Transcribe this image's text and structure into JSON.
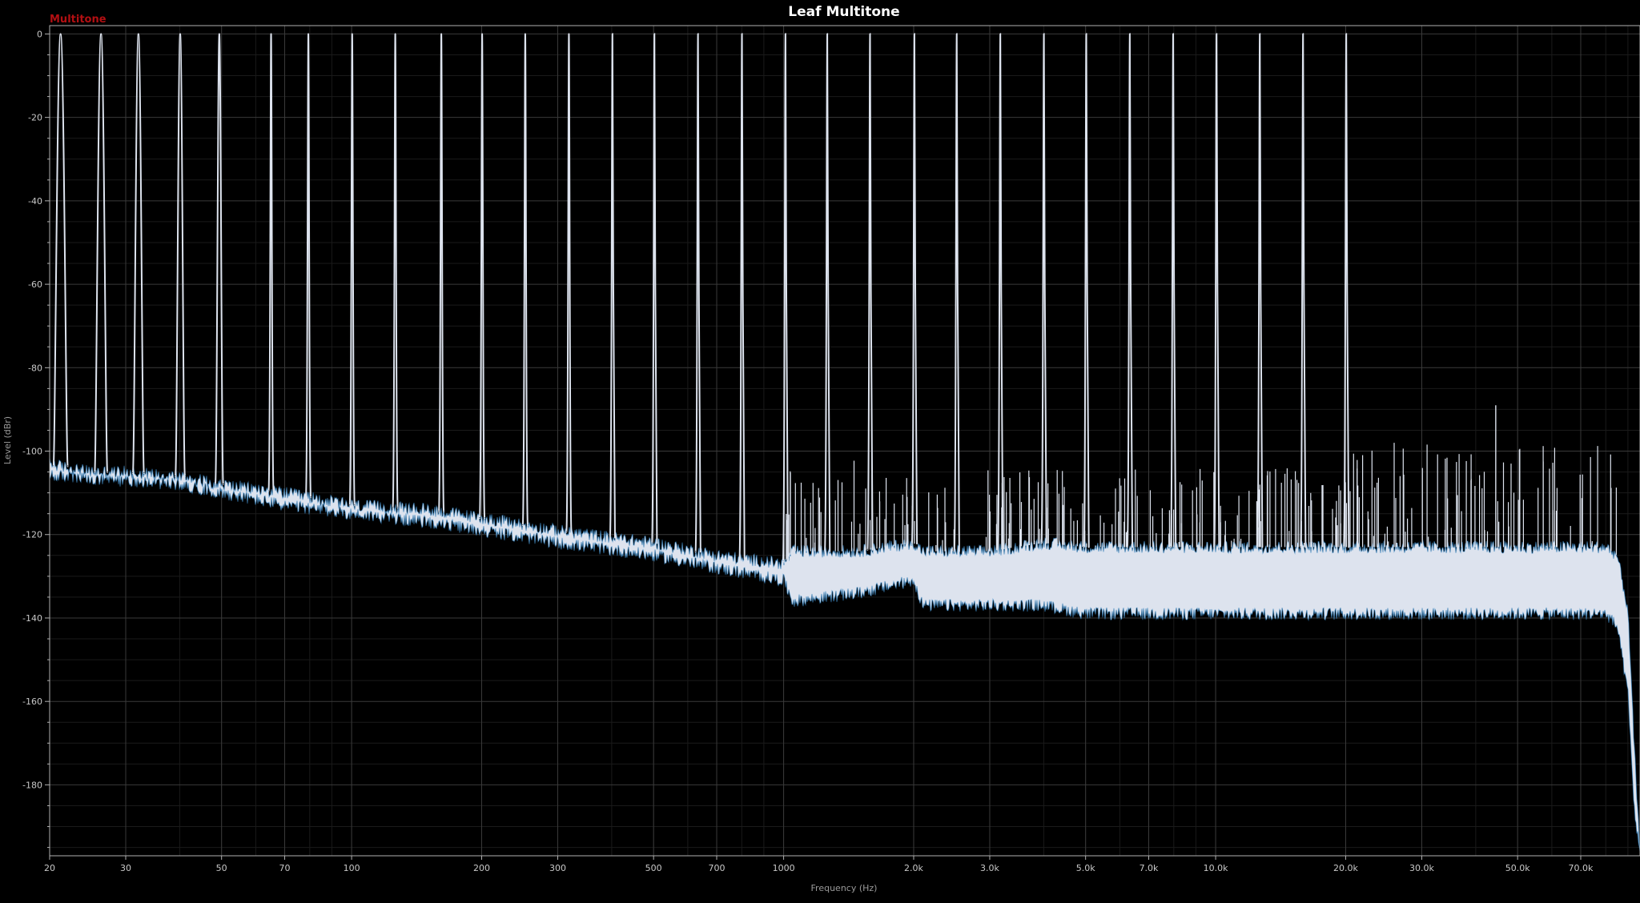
{
  "chart_data": {
    "type": "line",
    "title": "Leaf Multitone",
    "xlabel": "Frequency (Hz)",
    "ylabel": "Level (dBr)",
    "xscale": "log",
    "xlim": [
      20,
      96000
    ],
    "ylim": [
      -197,
      2
    ],
    "grid": true,
    "legend": {
      "entries": [
        "Multitone"
      ],
      "placement": "top-left"
    },
    "colors": {
      "background": "#000000",
      "trace": "#dde3ee",
      "trace_edge": "#2f86c8",
      "legend_text": "#b30f12",
      "grid": "#3a3a3a"
    },
    "x_ticks": [
      {
        "v": 20,
        "label": "20"
      },
      {
        "v": 30,
        "label": "30"
      },
      {
        "v": 50,
        "label": "50"
      },
      {
        "v": 70,
        "label": "70"
      },
      {
        "v": 100,
        "label": "100"
      },
      {
        "v": 200,
        "label": "200"
      },
      {
        "v": 300,
        "label": "300"
      },
      {
        "v": 500,
        "label": "500"
      },
      {
        "v": 700,
        "label": "700"
      },
      {
        "v": 1000,
        "label": "1000"
      },
      {
        "v": 2000,
        "label": "2.0k"
      },
      {
        "v": 3000,
        "label": "3.0k"
      },
      {
        "v": 5000,
        "label": "5.0k"
      },
      {
        "v": 7000,
        "label": "7.0k"
      },
      {
        "v": 10000,
        "label": "10.0k"
      },
      {
        "v": 20000,
        "label": "20.0k"
      },
      {
        "v": 30000,
        "label": "30.0k"
      },
      {
        "v": 50000,
        "label": "50.0k"
      },
      {
        "v": 70000,
        "label": "70.0k"
      }
    ],
    "y_ticks": [
      {
        "v": 0,
        "label": "0"
      },
      {
        "v": -20,
        "label": "-20"
      },
      {
        "v": -40,
        "label": "-40"
      },
      {
        "v": -60,
        "label": "-60"
      },
      {
        "v": -80,
        "label": "-80"
      },
      {
        "v": -100,
        "label": "-100"
      },
      {
        "v": -120,
        "label": "-120"
      },
      {
        "v": -140,
        "label": "-140"
      },
      {
        "v": -160,
        "label": "-160"
      },
      {
        "v": -180,
        "label": "-180"
      }
    ],
    "tones_hz": [
      21.2,
      26.3,
      32.1,
      40.1,
      49.4,
      65.1,
      79.4,
      100.3,
      126.2,
      161.3,
      200.5,
      252.3,
      318.4,
      401.6,
      502.3,
      633.6,
      800.9,
      1010,
      1262,
      1585,
      2008,
      2516,
      3174,
      4004,
      5019,
      6329,
      7975,
      10050,
      12655,
      15935,
      20060
    ],
    "tone_level_db": 0,
    "noise_floor": {
      "x": [
        20,
        22,
        25,
        30,
        40,
        50,
        70,
        100,
        150,
        200,
        300,
        500,
        700,
        1000,
        1050,
        1500,
        2000,
        2100,
        3000,
        4000,
        5000,
        10000,
        20000,
        50000,
        80000,
        85000,
        90000,
        93000,
        96000
      ],
      "upper": [
        -103,
        -104,
        -105,
        -105,
        -106,
        -108,
        -110,
        -113,
        -114,
        -116,
        -119,
        -122,
        -125,
        -127,
        -124,
        -124,
        -122,
        -124,
        -124,
        -122,
        -123,
        -123,
        -123,
        -123,
        -123,
        -125,
        -138,
        -170,
        -197
      ],
      "lower": [
        -106,
        -106,
        -107,
        -107,
        -108,
        -110,
        -113,
        -115,
        -117,
        -119,
        -122,
        -125,
        -128,
        -131,
        -136,
        -134,
        -131,
        -137,
        -137,
        -137,
        -139,
        -139,
        -139,
        -139,
        -139,
        -142,
        -158,
        -185,
        -197
      ]
    },
    "spur_bands": [
      {
        "x": [
          1000,
          2000
        ],
        "peak_db": -102
      },
      {
        "x": [
          2000,
          20000
        ],
        "peak_db": -104
      },
      {
        "x": [
          20000,
          85000
        ],
        "peak_db": -98
      }
    ],
    "max_spur": {
      "x": 44500,
      "y": -89
    }
  }
}
